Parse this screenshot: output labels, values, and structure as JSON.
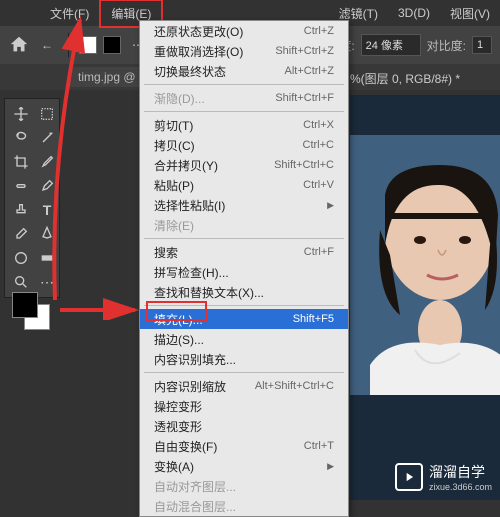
{
  "menubar": {
    "file": "文件(F)",
    "edit": "编辑(E)",
    "filter": "滤镜(T)",
    "threed": "3D(D)",
    "view": "视图(V)"
  },
  "toolbar": {
    "width_label": "宽度:",
    "width_value": "24 像素",
    "contrast_label": "对比度:",
    "contrast_value": "1"
  },
  "tab": {
    "filename": "timg.jpg @",
    "mode_suffix": "%(图层 0, RGB/8#) *"
  },
  "menu": {
    "undo": {
      "label": "还原状态更改(O)",
      "shortcut": "Ctrl+Z"
    },
    "redo": {
      "label": "重做取消选择(O)",
      "shortcut": "Shift+Ctrl+Z"
    },
    "toggle": {
      "label": "切换最终状态",
      "shortcut": "Alt+Ctrl+Z"
    },
    "fade": {
      "label": "渐隐(D)...",
      "shortcut": "Shift+Ctrl+F"
    },
    "cut": {
      "label": "剪切(T)",
      "shortcut": "Ctrl+X"
    },
    "copy": {
      "label": "拷贝(C)",
      "shortcut": "Ctrl+C"
    },
    "copymerged": {
      "label": "合并拷贝(Y)",
      "shortcut": "Shift+Ctrl+C"
    },
    "paste": {
      "label": "粘贴(P)",
      "shortcut": "Ctrl+V"
    },
    "pastespecial": {
      "label": "选择性粘贴(I)"
    },
    "clear": {
      "label": "清除(E)"
    },
    "search": {
      "label": "搜索",
      "shortcut": "Ctrl+F"
    },
    "spellcheck": {
      "label": "拼写检查(H)..."
    },
    "findreplace": {
      "label": "查找和替换文本(X)..."
    },
    "fill": {
      "label": "填充(L)...",
      "shortcut": "Shift+F5"
    },
    "stroke": {
      "label": "描边(S)..."
    },
    "contentfill": {
      "label": "内容识别填充..."
    },
    "contentscale": {
      "label": "内容识别缩放",
      "shortcut": "Alt+Shift+Ctrl+C"
    },
    "puppet": {
      "label": "操控变形"
    },
    "perspective": {
      "label": "透视变形"
    },
    "freetransform": {
      "label": "自由变换(F)",
      "shortcut": "Ctrl+T"
    },
    "transform": {
      "label": "变换(A)"
    },
    "autoalign": {
      "label": "自动对齐图层..."
    },
    "autoblend": {
      "label": "自动混合图层..."
    }
  },
  "watermark": {
    "brand": "溜溜自学",
    "url": "zixue.3d66.com"
  }
}
